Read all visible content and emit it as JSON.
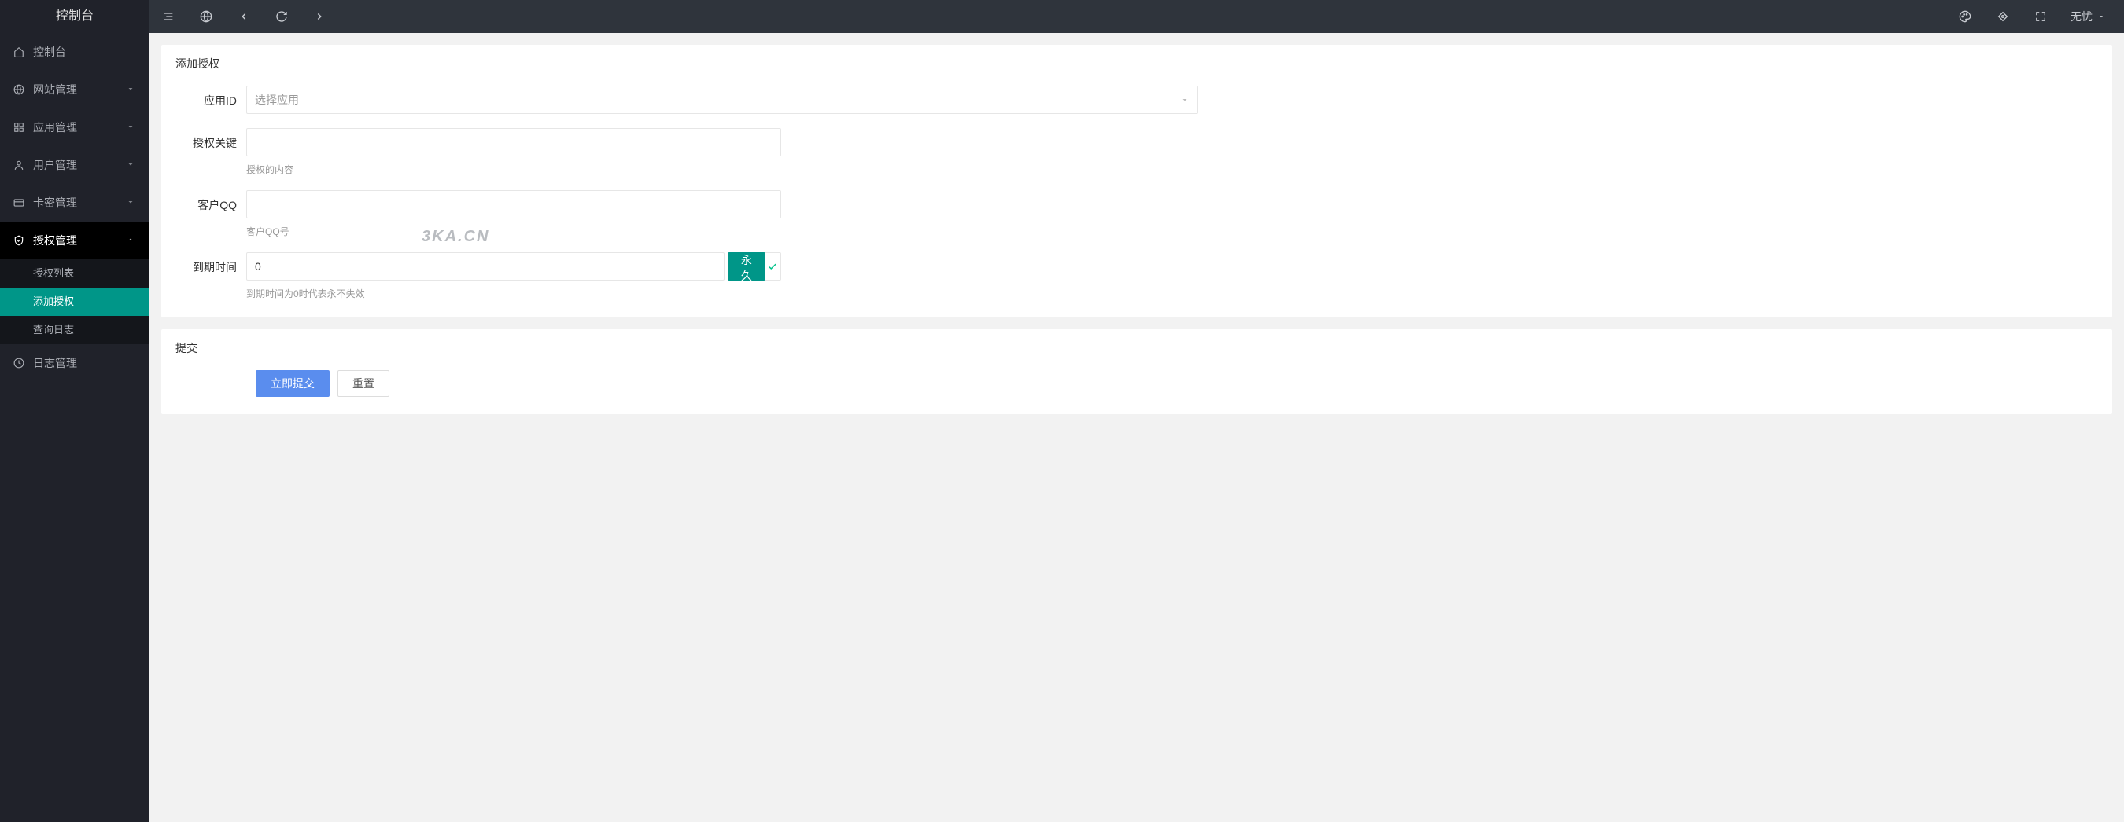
{
  "brand": "控制台",
  "topbar": {
    "user_name": "无忧"
  },
  "sidebar": {
    "items": [
      {
        "icon": "home",
        "label": "控制台",
        "expandable": false
      },
      {
        "icon": "globe",
        "label": "网站管理",
        "expandable": true
      },
      {
        "icon": "grid",
        "label": "应用管理",
        "expandable": true
      },
      {
        "icon": "user",
        "label": "用户管理",
        "expandable": true
      },
      {
        "icon": "card",
        "label": "卡密管理",
        "expandable": true
      },
      {
        "icon": "shield",
        "label": "授权管理",
        "expandable": true,
        "expanded": true,
        "children": [
          {
            "label": "授权列表",
            "active": false
          },
          {
            "label": "添加授权",
            "active": true
          },
          {
            "label": "查询日志",
            "active": false
          }
        ]
      },
      {
        "icon": "clock",
        "label": "日志管理",
        "expandable": false
      }
    ]
  },
  "form": {
    "card_title": "添加授权",
    "app_id_label": "应用ID",
    "app_id_placeholder": "选择应用",
    "auth_key_label": "授权关键",
    "auth_key_help": "授权的内容",
    "customer_qq_label": "客户QQ",
    "customer_qq_help": "客户QQ号",
    "expire_label": "到期时间",
    "expire_value": "0",
    "expire_help": "到期时间为0时代表永不失效",
    "permanent_btn": "永久"
  },
  "submit_card": {
    "title": "提交",
    "submit_btn": "立即提交",
    "reset_btn": "重置"
  },
  "watermark": "3KA.CN"
}
